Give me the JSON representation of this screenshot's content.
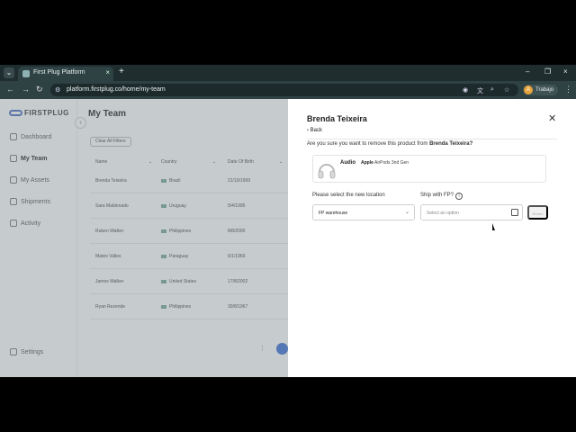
{
  "browser": {
    "tab_title": "First Plug Platform",
    "url": "platform.firstplug.co/home/my-team",
    "profile_name": "Trabajo",
    "profile_initial": "A"
  },
  "icons": {
    "tab_menu": "⌄",
    "tab_close": "×",
    "new_tab": "+",
    "minimize": "–",
    "restore": "❐",
    "close": "×",
    "back": "←",
    "forward": "→",
    "reload": "↻",
    "site_info": "⚙",
    "eye_off": "◉",
    "translate": "文",
    "zoom": "⌕",
    "bookmark": "☆",
    "menu": "⋮",
    "collapse": "‹",
    "info": "i",
    "chevron_down": "⌄",
    "drawer_close": "✕"
  },
  "sidebar": {
    "logo": "FIRSTPLUG",
    "items": [
      {
        "label": "Dashboard"
      },
      {
        "label": "My Team"
      },
      {
        "label": "My Assets"
      },
      {
        "label": "Shipments"
      },
      {
        "label": "Activity"
      }
    ],
    "settings": "Settings"
  },
  "main": {
    "title": "My Team",
    "clear_filters": "Clear All Filters",
    "columns": [
      "Name",
      "Country",
      "Date Of Birth"
    ],
    "rows": [
      {
        "name": "Brenda Teixeira",
        "country": "Brazil",
        "dob": "21/10/1969"
      },
      {
        "name": "Sara Maldonado",
        "country": "Uruguay",
        "dob": "5/4/1995"
      },
      {
        "name": "Ruben Walker",
        "country": "Philippines",
        "dob": "8/8/2000"
      },
      {
        "name": "Mateo Valles",
        "country": "Paraguay",
        "dob": "6/1/1969"
      },
      {
        "name": "James Walker",
        "country": "United States",
        "dob": "17/8/2002"
      },
      {
        "name": "Ryan Rezende",
        "country": "Philippines",
        "dob": "30/8/1967"
      }
    ]
  },
  "drawer": {
    "title": "Brenda Teixeira",
    "back": "Back",
    "question_prefix": "Are you sure you want to remove this product from ",
    "question_name": "Brenda Teixeira?",
    "product": {
      "category": "Audio",
      "brand": "Apple",
      "model": "AirPods 3nd Gen"
    },
    "location_label": "Please select the new location",
    "location_value": "FP warehouse",
    "ship_label": "Ship with FP?",
    "date_placeholder": "Select an option",
    "return_label": "Return"
  }
}
